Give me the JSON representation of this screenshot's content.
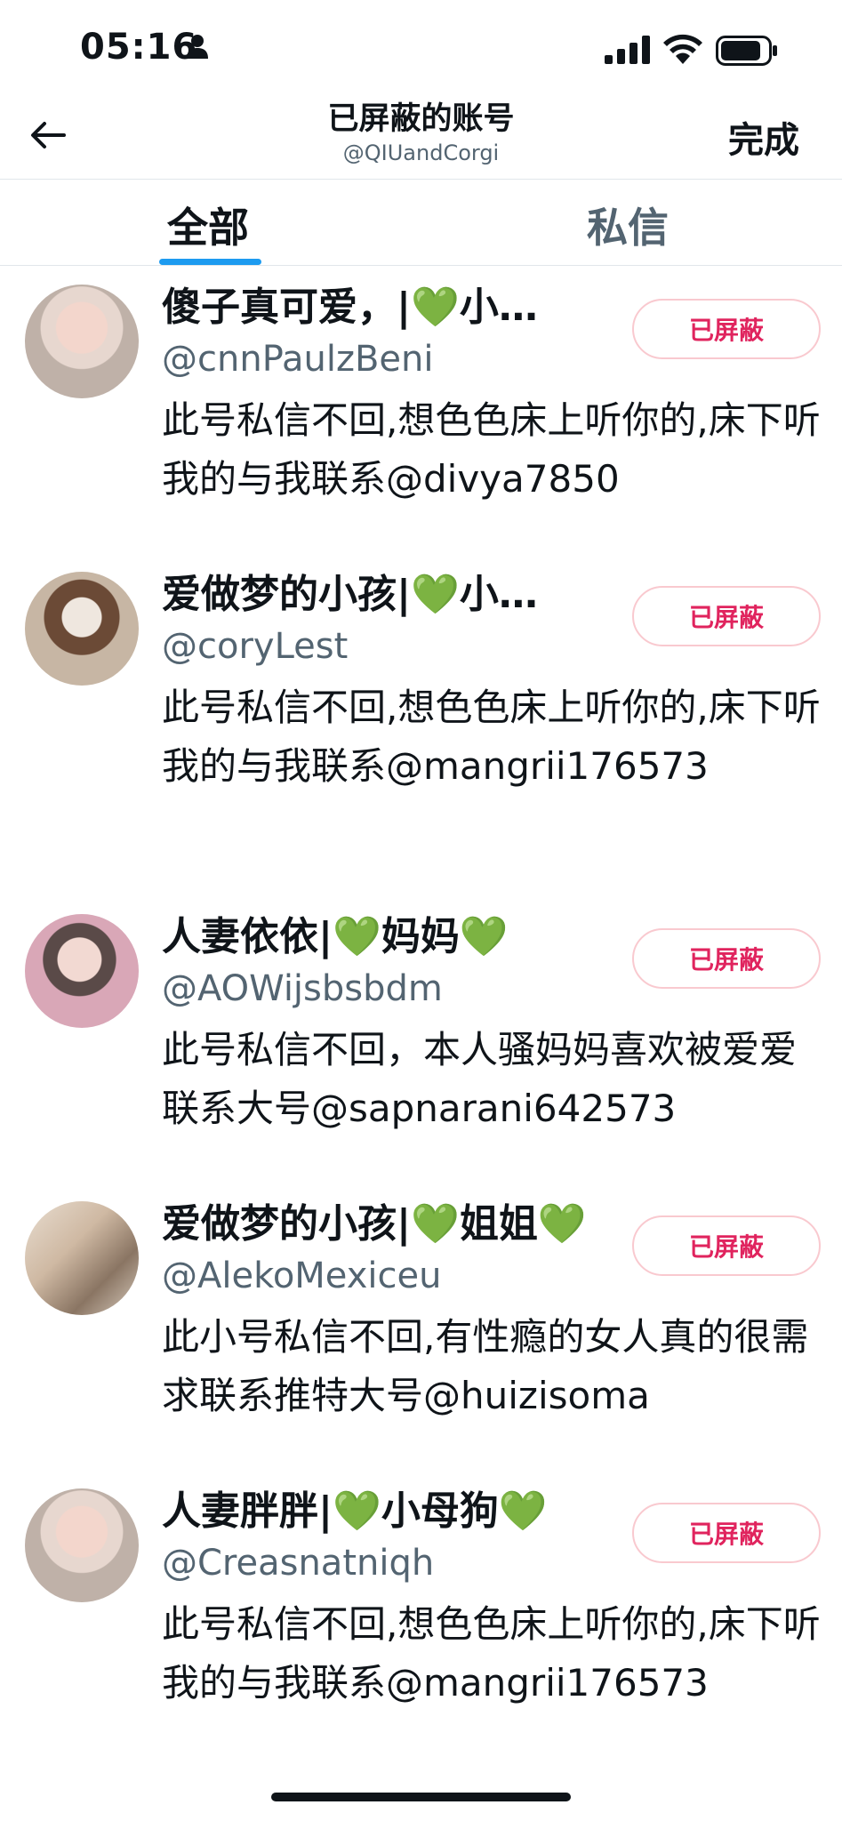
{
  "status_bar": {
    "time": "05:16"
  },
  "header": {
    "title": "已屏蔽的账号",
    "subtitle": "@QIUandCorgi",
    "done_label": "完成"
  },
  "tabs": [
    {
      "label": "全部",
      "active": true
    },
    {
      "label": "私信",
      "active": false
    }
  ],
  "accounts": [
    {
      "name": "傻子真可爱，|💚小…",
      "handle": "@cnnPaulzBeni",
      "bio": "此号私信不回,想色色床上听你的,床下听我的与我联系@divya7850",
      "button": "已屏蔽"
    },
    {
      "name": "爱做梦的小孩|💚小…",
      "handle": "@coryLest",
      "bio": "此号私信不回,想色色床上听你的,床下听我的与我联系@mangrii176573",
      "button": "已屏蔽"
    },
    {
      "name": "人妻依依|💚妈妈💚",
      "handle": "@AOWijsbsbdm",
      "bio": "此号私信不回，本人骚妈妈喜欢被爱爱联系大号@sapnarani642573",
      "button": "已屏蔽"
    },
    {
      "name": "爱做梦的小孩|💚姐姐💚",
      "handle": "@AlekoMexiceu",
      "bio": "此小号私信不回,有性瘾的女人真的很需求联系推特大号@huizisoma",
      "button": "已屏蔽"
    },
    {
      "name": "人妻胖胖|💚小母狗💚",
      "handle": "@Creasnatniqh",
      "bio": "此号私信不回,想色色床上听你的,床下听我的与我联系@mangrii176573",
      "button": "已屏蔽"
    }
  ],
  "colors": {
    "accent": "#1d9bf0",
    "blocked_text": "#e0245e",
    "blocked_border": "#f9c9cf",
    "secondary_text": "#536471"
  }
}
